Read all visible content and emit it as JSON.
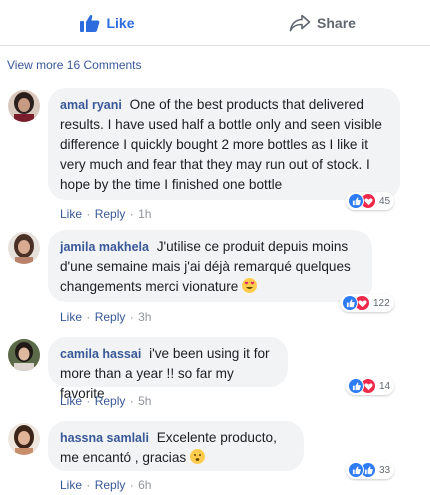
{
  "actions": {
    "like_label": "Like",
    "share_label": "Share"
  },
  "view_more": "View more 16 Comments",
  "comments": [
    {
      "author": "amal ryani",
      "text": "One of the best products that delivered results. I have used half a bottle only and seen visible difference I quickly bought 2 more bottles as I like it very much and fear that they may run out of stock. I hope by the time I finished one bottle",
      "reaction_count": "45",
      "like": "Like",
      "reply": "Reply",
      "time": "1h"
    },
    {
      "author": "jamila makhela",
      "text": "J'utilise ce produit depuis moins d'une semaine mais j'ai déjà remarqué quelques changements merci vionature",
      "reaction_count": "122",
      "like": "Like",
      "reply": "Reply",
      "time": "3h"
    },
    {
      "author": "camila hassai",
      "text": "i've been using it for more than a year !! so far my favorite",
      "reaction_count": "14",
      "like": "Like",
      "reply": "Reply",
      "time": "5h"
    },
    {
      "author": "hassna samlali",
      "text": "Excelente producto, me encantó , gracias",
      "reaction_count": "33",
      "like": "Like",
      "reply": "Reply",
      "time": "6h"
    }
  ],
  "colors": {
    "link": "#385898",
    "like_blue": "#2d6cdf",
    "bubble": "#f2f3f5",
    "love_red": "#f0284a"
  }
}
